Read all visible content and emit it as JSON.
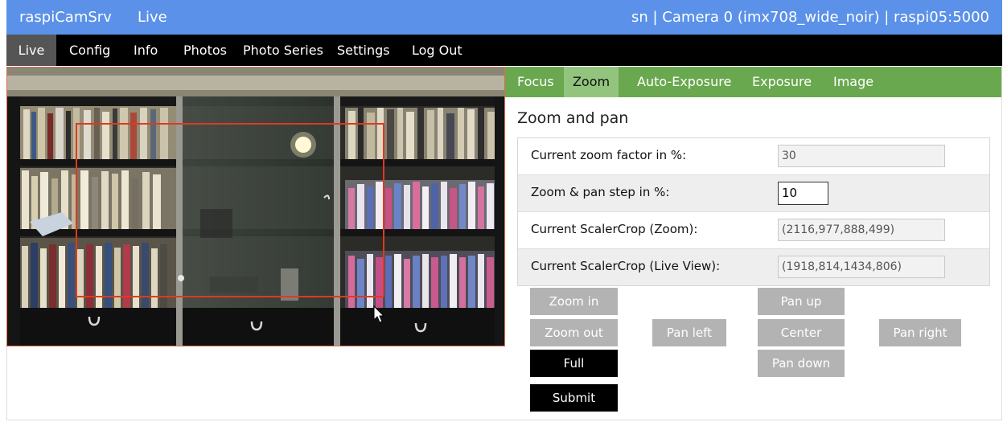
{
  "topbar": {
    "brand": "raspiCamSrv",
    "page": "Live",
    "status": "sn | Camera 0 (imx708_wide_noir) | raspi05:5000"
  },
  "nav": {
    "items": [
      "Live",
      "Config",
      "Info",
      "Photos",
      "Photo Series",
      "Settings",
      "Log Out"
    ],
    "active": "Live"
  },
  "tabs": {
    "items": [
      "Focus",
      "Zoom",
      "Auto-Exposure",
      "Exposure",
      "Image"
    ],
    "active": "Zoom"
  },
  "section": {
    "title": "Zoom and pan"
  },
  "props": {
    "zoom_factor": {
      "label": "Current zoom factor in %:",
      "value": "30"
    },
    "step": {
      "label": "Zoom & pan step in %:",
      "value": "10"
    },
    "scaler_zoom": {
      "label": "Current ScalerCrop (Zoom):",
      "value": "(2116,977,888,499)"
    },
    "scaler_live": {
      "label": "Current ScalerCrop (Live View):",
      "value": "(1918,814,1434,806)"
    }
  },
  "buttons": {
    "zoom_in": "Zoom in",
    "zoom_out": "Zoom out",
    "full": "Full",
    "pan_left": "Pan left",
    "pan_up": "Pan up",
    "center": "Center",
    "pan_down": "Pan down",
    "pan_right": "Pan right",
    "submit": "Submit"
  },
  "colors": {
    "topbar": "#5b91e8",
    "navbar": "#000000",
    "tabs": "#6aa84f",
    "tab_active": "#93c47d",
    "zoom_rect": "#e0391e"
  }
}
